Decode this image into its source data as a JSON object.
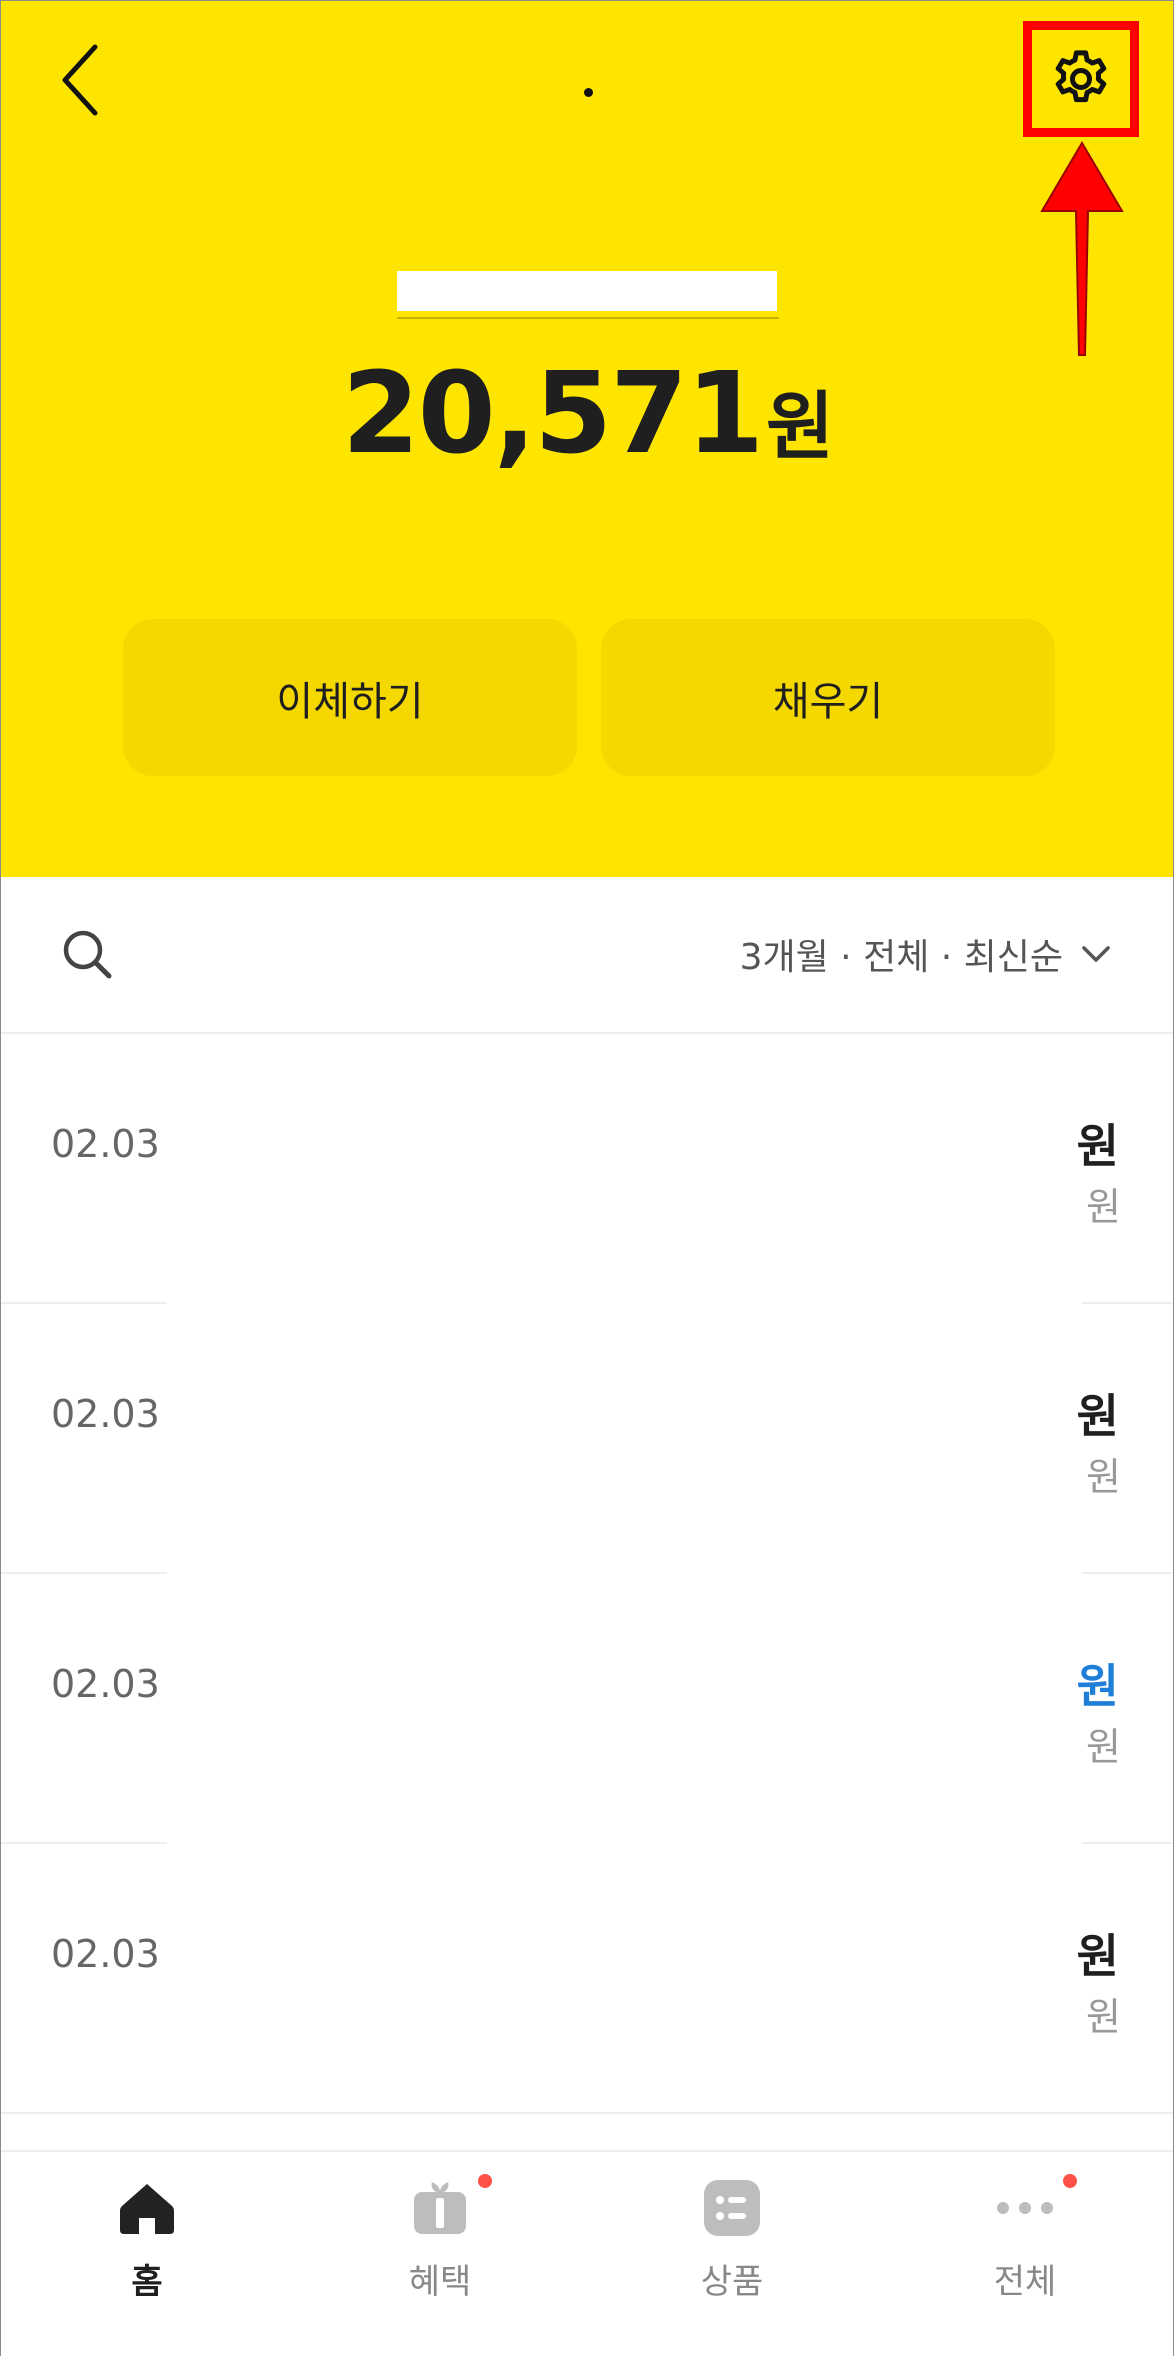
{
  "header": {
    "title_dot": "·",
    "balance_amount": "20,571",
    "balance_unit": "원",
    "actions": {
      "transfer": "이체하기",
      "charge": "채우기"
    }
  },
  "filter": {
    "label": "3개월 · 전체 · 최신순"
  },
  "transactions": [
    {
      "date": "02.03",
      "amount": "원",
      "balance": "원",
      "amount_color": "#1f1f1f"
    },
    {
      "date": "02.03",
      "amount": "원",
      "balance": "원",
      "amount_color": "#1f1f1f"
    },
    {
      "date": "02.03",
      "amount": "원",
      "balance": "원",
      "amount_color": "#1F7FD8"
    },
    {
      "date": "02.03",
      "amount": "원",
      "balance": "원",
      "amount_color": "#1f1f1f"
    }
  ],
  "nav": {
    "items": [
      {
        "label": "홈",
        "icon": "home-icon",
        "active": true
      },
      {
        "label": "혜택",
        "icon": "gift-icon",
        "badge": true
      },
      {
        "label": "상품",
        "icon": "list-icon"
      },
      {
        "label": "전체",
        "icon": "more-icon",
        "badge": true
      }
    ]
  },
  "colors": {
    "brand_yellow": "#FEE500",
    "button_yellow": "#F4D800",
    "badge_red": "#FF5147",
    "highlight_red": "#FF0000",
    "income_blue": "#1F7FD8"
  }
}
